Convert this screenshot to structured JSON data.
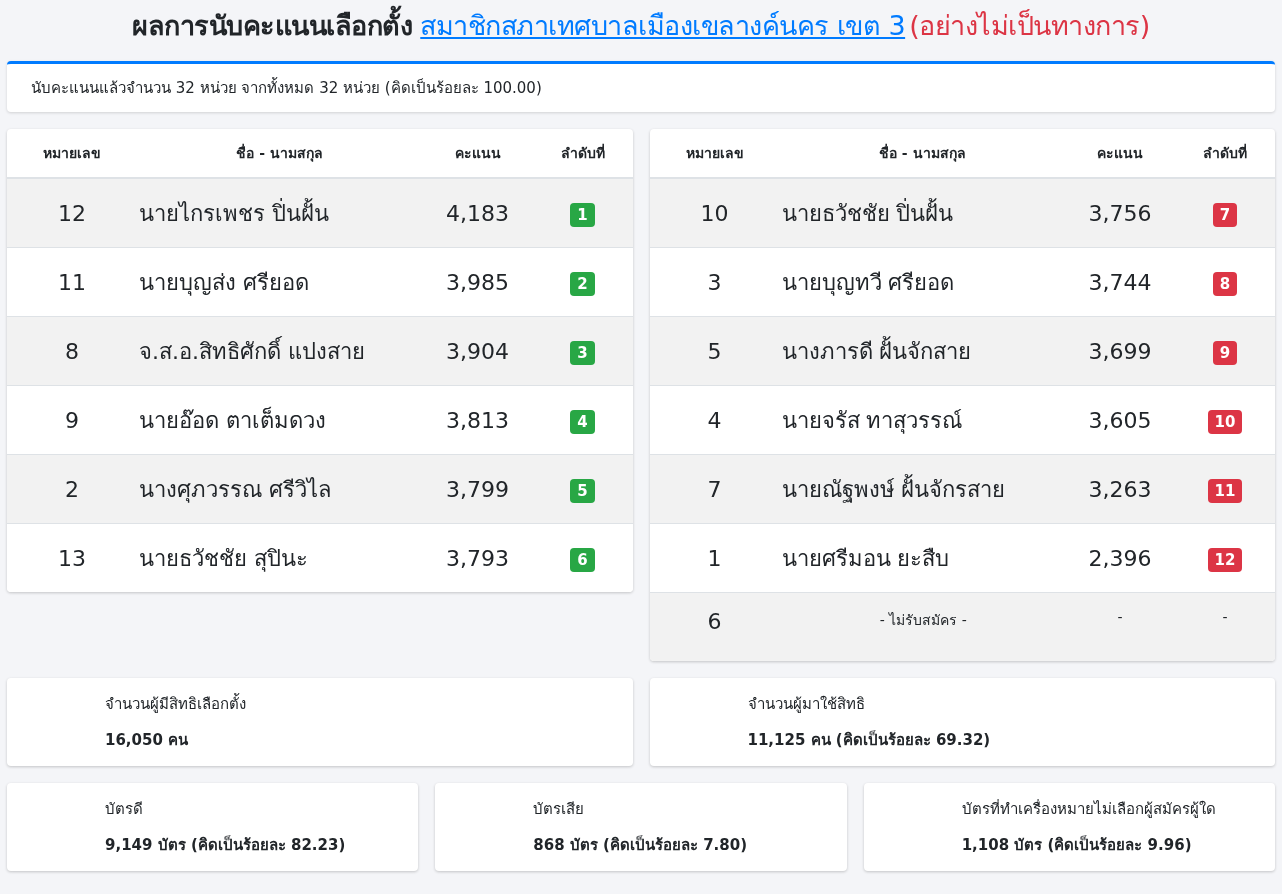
{
  "header": {
    "title": "ผลการนับคะแนนเลือกตั้ง",
    "link": "สมาชิกสภาเทศบาลเมืองเขลางค์นคร เขต 3",
    "note": "(อย่างไม่เป็นทางการ)"
  },
  "progress": {
    "text": "นับคะแนนแล้วจำนวน 32 หน่วย จากทั้งหมด 32 หน่วย (คิดเป็นร้อยละ 100.00)"
  },
  "tables": [
    {
      "columns": [
        "หมายเลข",
        "ชื่อ - นามสกุล",
        "คะแนน",
        "ลำดับที่"
      ],
      "rows": [
        {
          "kind": "candidate",
          "number": "12",
          "name": "นายไกรเพชร ปิ่นฝั้น",
          "votes": "4,183",
          "rank": "1",
          "color": "#28a745"
        },
        {
          "kind": "candidate",
          "number": "11",
          "name": "นายบุญส่ง ศรียอด",
          "votes": "3,985",
          "rank": "2",
          "color": "#28a745"
        },
        {
          "kind": "candidate",
          "number": "8",
          "name": "จ.ส.อ.สิทธิศักดิ์ แปงสาย",
          "votes": "3,904",
          "rank": "3",
          "color": "#28a745"
        },
        {
          "kind": "candidate",
          "number": "9",
          "name": "นายอ๊อด ตาเต็มดวง",
          "votes": "3,813",
          "rank": "4",
          "color": "#28a745"
        },
        {
          "kind": "candidate",
          "number": "2",
          "name": "นางศุภวรรณ ศรีวิไล",
          "votes": "3,799",
          "rank": "5",
          "color": "#28a745"
        },
        {
          "kind": "candidate",
          "number": "13",
          "name": "นายธวัชชัย สุปินะ",
          "votes": "3,793",
          "rank": "6",
          "color": "#28a745"
        }
      ]
    },
    {
      "columns": [
        "หมายเลข",
        "ชื่อ - นามสกุล",
        "คะแนน",
        "ลำดับที่"
      ],
      "rows": [
        {
          "kind": "candidate",
          "number": "10",
          "name": "นายธวัชชัย ปิ่นฝั้น",
          "votes": "3,756",
          "rank": "7",
          "color": "#dc3545"
        },
        {
          "kind": "candidate",
          "number": "3",
          "name": "นายบุญทวี ศรียอด",
          "votes": "3,744",
          "rank": "8",
          "color": "#dc3545"
        },
        {
          "kind": "candidate",
          "number": "5",
          "name": "นางภารดี ฝั้นจักสาย",
          "votes": "3,699",
          "rank": "9",
          "color": "#dc3545"
        },
        {
          "kind": "candidate",
          "number": "4",
          "name": "นายจรัส ทาสุวรรณ์",
          "votes": "3,605",
          "rank": "10",
          "color": "#dc3545"
        },
        {
          "kind": "candidate",
          "number": "7",
          "name": "นายณัฐพงษ์ ฝั้นจักรสาย",
          "votes": "3,263",
          "rank": "11",
          "color": "#dc3545"
        },
        {
          "kind": "candidate",
          "number": "1",
          "name": "นายศรีมอน ยะสืบ",
          "votes": "2,396",
          "rank": "12",
          "color": "#dc3545"
        },
        {
          "kind": "vacant",
          "number": "6",
          "name": "- ไม่รับสมัคร -",
          "votes": "-",
          "rank": "-"
        }
      ]
    }
  ],
  "stats": [
    [
      {
        "label": "จำนวนผู้มีสิทธิเลือกตั้ง",
        "value": "16,050 คน"
      },
      {
        "label": "จำนวนผู้มาใช้สิทธิ",
        "value": "11,125 คน (คิดเป็นร้อยละ 69.32)"
      }
    ],
    [
      {
        "label": "บัตรดี",
        "value": "9,149 บัตร (คิดเป็นร้อยละ 82.23)"
      },
      {
        "label": "บัตรเสีย",
        "value": "868 บัตร (คิดเป็นร้อยละ 7.80)"
      },
      {
        "label": "บัตรที่ทำเครื่องหมายไม่เลือกผู้สมัครผู้ใด",
        "value": "1,108 บัตร (คิดเป็นร้อยละ 9.96)"
      }
    ]
  ]
}
